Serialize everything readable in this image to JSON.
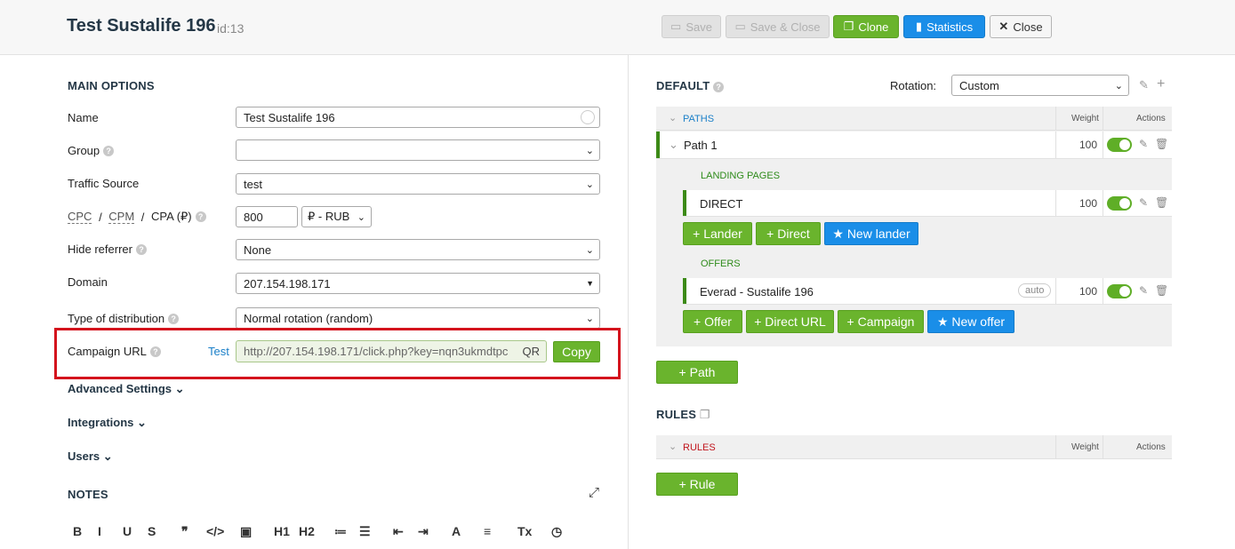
{
  "header": {
    "title": "Test Sustalife 196",
    "id_label": "id:13",
    "buttons": {
      "save": "Save",
      "save_close": "Save & Close",
      "clone": "Clone",
      "statistics": "Statistics",
      "close": "Close"
    }
  },
  "main_options": {
    "section_title": "MAIN OPTIONS",
    "name": {
      "label": "Name",
      "value": "Test Sustalife 196"
    },
    "group": {
      "label": "Group",
      "value": ""
    },
    "traffic_source": {
      "label": "Traffic Source",
      "value": "test"
    },
    "cost": {
      "cpc": "CPC",
      "slash1": " / ",
      "cpm": "CPM",
      "slash2": " / ",
      "cpa": "CPA (₽)",
      "value": "800",
      "currency": "₽ - RUB"
    },
    "hide_referrer": {
      "label": "Hide referrer",
      "value": "None"
    },
    "domain": {
      "label": "Domain",
      "value": "207.154.198.171"
    },
    "distribution": {
      "label": "Type of distribution",
      "value": "Normal rotation (random)"
    },
    "campaign_url": {
      "label": "Campaign URL",
      "test_link": "Test",
      "value": "http://207.154.198.171/click.php?key=nqn3ukmdtpc",
      "qr": "QR",
      "copy": "Copy"
    },
    "advanced": "Advanced Settings",
    "integrations": "Integrations",
    "users": "Users",
    "notes": "NOTES"
  },
  "editor_toolbar": [
    "B",
    "I",
    "U",
    "S",
    "❞",
    "</>",
    "▣",
    "H1",
    "H2",
    "≔",
    "☰",
    "⇤",
    "⇥",
    "A",
    "≡",
    "Tx",
    "◷"
  ],
  "default_panel": {
    "title": "DEFAULT",
    "rotation_label": "Rotation:",
    "rotation_value": "Custom",
    "paths_header": "PATHS",
    "weight_header": "Weight",
    "actions_header": "Actions",
    "path1": {
      "name": "Path 1",
      "weight": "100"
    },
    "landing_pages_label": "LANDING PAGES",
    "lander": {
      "name": "DIRECT",
      "weight": "100"
    },
    "lander_buttons": {
      "lander": "Lander",
      "direct": "Direct",
      "new_lander": "New lander"
    },
    "offers_label": "OFFERS",
    "offer": {
      "name": "Everad - Sustalife 196",
      "badge": "auto",
      "weight": "100"
    },
    "offer_buttons": {
      "offer": "Offer",
      "direct_url": "Direct URL",
      "campaign": "Campaign",
      "new_offer": "New offer"
    },
    "add_path": "Path"
  },
  "rules_panel": {
    "title": "RULES",
    "rules_header": "RULES",
    "weight_header": "Weight",
    "actions_header": "Actions",
    "add_rule": "Rule"
  },
  "colors": {
    "accent_green": "#6ab42d",
    "accent_blue": "#1a8ee8",
    "highlight_red": "#d4131d"
  }
}
